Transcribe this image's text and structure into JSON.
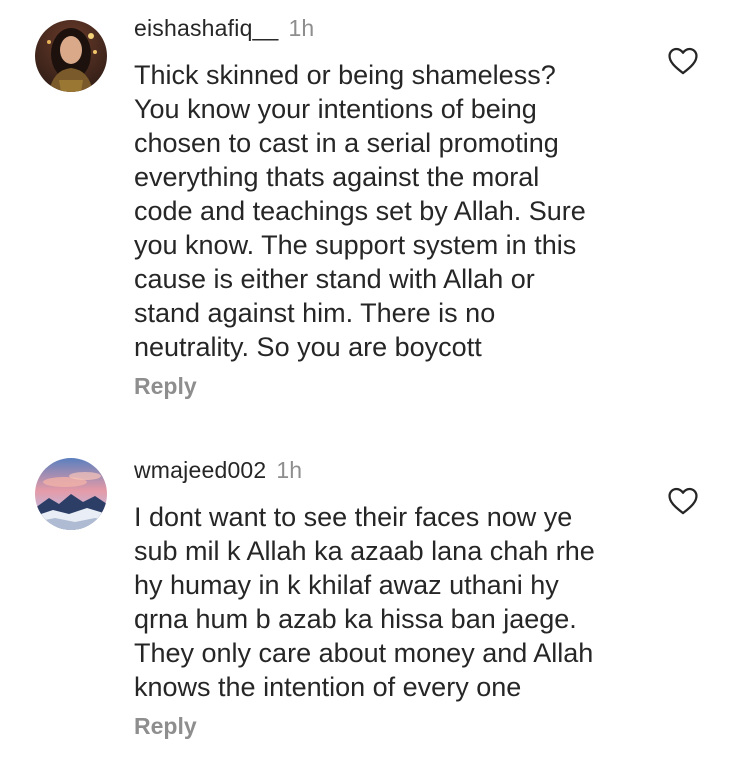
{
  "comments": [
    {
      "username": "eishashafiq__",
      "time": "1h",
      "text": "Thick skinned or being shameless?\nYou know your intentions of being\nchosen to cast in a serial promoting\neverything thats against the moral\ncode and teachings set by Allah. Sure\nyou know. The support system in this\ncause is either stand with Allah or\nstand against him. There is no\nneutrality. So you are boycott",
      "reply_label": "Reply",
      "avatar_icon": "profile-photo",
      "like_icon": "heart-outline-icon"
    },
    {
      "username": "wmajeed002",
      "time": "1h",
      "text": "I dont want to see their faces now ye\nsub mil k Allah ka azaab lana chah rhe\nhy humay in k khilaf awaz uthani hy\nqrna hum b azab ka hissa ban jaege.\nThey only care about money and Allah\nknows the intention of every one",
      "reply_label": "Reply",
      "avatar_icon": "landscape-profile-photo",
      "like_icon": "heart-outline-icon"
    }
  ],
  "colors": {
    "text": "#262626",
    "secondary": "#8e8e8e",
    "background": "#ffffff"
  }
}
